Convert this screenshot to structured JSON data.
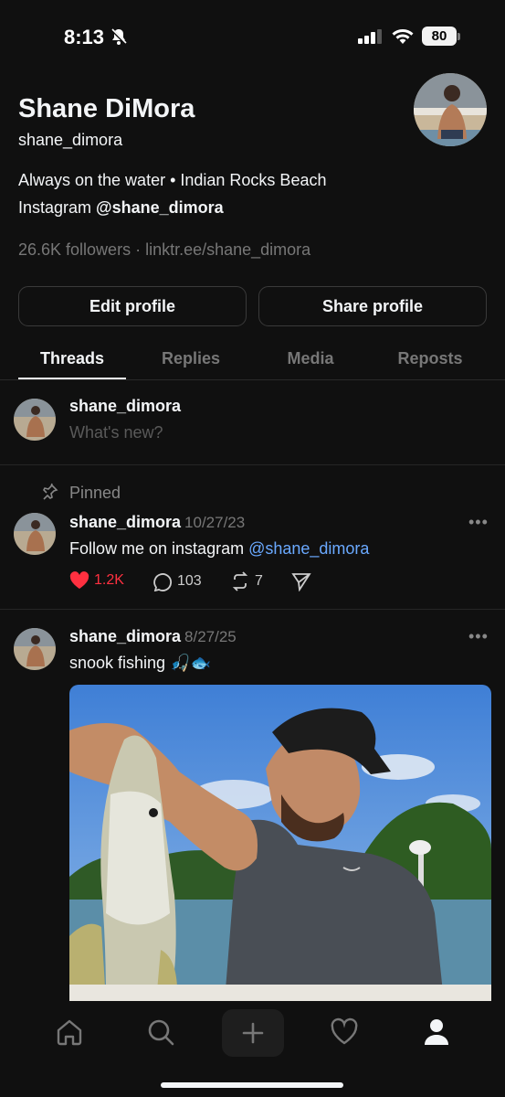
{
  "status_bar": {
    "time": "8:13",
    "battery": "80",
    "icons": [
      "bell-slash-icon",
      "signal-icon",
      "wifi-icon",
      "battery-icon"
    ]
  },
  "profile": {
    "display_name": "Shane DiMora",
    "username": "shane_dimora",
    "bio_line1": "Always on the water • Indian Rocks Beach",
    "bio_line2_prefix": "Instagram ",
    "bio_line2_handle": "@shane_dimora",
    "followers": "26.6K followers",
    "separator": " · ",
    "link": "linktr.ee/shane_dimora"
  },
  "buttons": {
    "edit": "Edit profile",
    "share": "Share profile"
  },
  "tabs": [
    {
      "label": "Threads",
      "active": true
    },
    {
      "label": "Replies",
      "active": false
    },
    {
      "label": "Media",
      "active": false
    },
    {
      "label": "Reposts",
      "active": false
    }
  ],
  "composer": {
    "username": "shane_dimora",
    "placeholder": "What's new?"
  },
  "posts": [
    {
      "pinned_label": "Pinned",
      "username": "shane_dimora",
      "date": "10/27/23",
      "text_prefix": "Follow me on instagram ",
      "text_mention": "@shane_dimora",
      "likes": "1.2K",
      "replies": "103",
      "reposts": "7",
      "more": "•••"
    },
    {
      "username": "shane_dimora",
      "date": "8/27/25",
      "text": "snook fishing 🎣🐟",
      "more": "•••"
    }
  ],
  "nav": [
    "home-icon",
    "search-icon",
    "plus-icon",
    "heart-icon",
    "profile-icon"
  ],
  "colors": {
    "background": "#101010",
    "text": "#f3f5f7",
    "muted": "#777777",
    "link": "#6aa9ff",
    "like": "#ff3040"
  }
}
